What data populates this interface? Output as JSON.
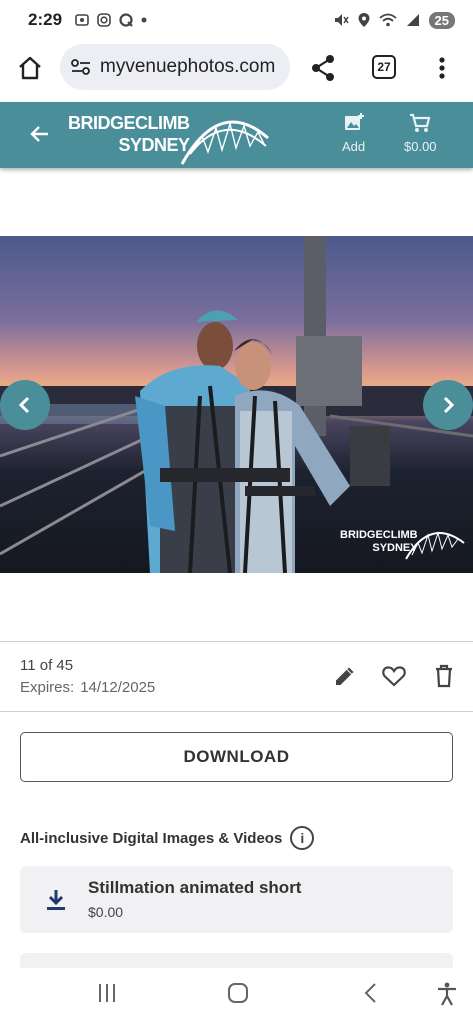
{
  "status_bar": {
    "time": "2:29",
    "battery": "25",
    "left_icons": [
      "screen-record-icon",
      "instagram-icon",
      "app-q-icon",
      "dot-icon"
    ],
    "right_icons": [
      "mute-icon",
      "location-icon",
      "wifi-icon",
      "signal-icon"
    ]
  },
  "browser": {
    "url": "myvenuephotos.com",
    "tabs_count": "27"
  },
  "header": {
    "logo_line1": "BRIDGECLIMB",
    "logo_line2": "SYDNEY",
    "add_label": "Add",
    "cart_total": "$0.00",
    "color": "#4a8e9a"
  },
  "photo": {
    "watermark_line1": "BRIDGECLIMB",
    "watermark_line2": "SYDNEY"
  },
  "photo_info": {
    "counter": "11 of 45",
    "expires_label": "Expires:",
    "expires_date": "14/12/2025"
  },
  "download": {
    "label": "DOWNLOAD"
  },
  "section": {
    "title": "All-inclusive Digital Images & Videos",
    "info_icon": "i"
  },
  "product": {
    "name": "Stillmation animated short",
    "price": "$0.00",
    "icon": "download-icon"
  }
}
